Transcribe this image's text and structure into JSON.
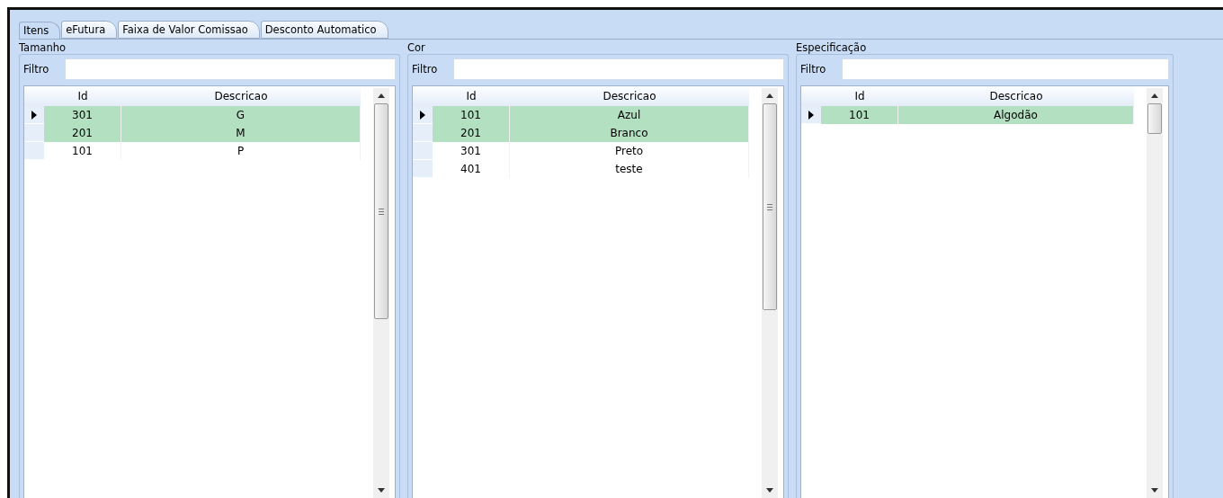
{
  "tabs": [
    {
      "label": "Itens",
      "selected": true
    },
    {
      "label": "eFutura",
      "selected": false
    },
    {
      "label": "Faixa de Valor Comissao",
      "selected": false
    },
    {
      "label": "Desconto Automatico",
      "selected": false
    }
  ],
  "panels": [
    {
      "title": "Tamanho",
      "filter_label": "Filtro",
      "columns": [
        "Id",
        "Descricao"
      ],
      "rows": [
        {
          "id": "301",
          "descricao": "G",
          "selected": true,
          "current": true
        },
        {
          "id": "201",
          "descricao": "M",
          "selected": true,
          "current": false
        },
        {
          "id": "101",
          "descricao": "P",
          "selected": false,
          "current": false
        }
      ]
    },
    {
      "title": "Cor",
      "filter_label": "Filtro",
      "columns": [
        "Id",
        "Descricao"
      ],
      "rows": [
        {
          "id": "101",
          "descricao": "Azul",
          "selected": true,
          "current": true
        },
        {
          "id": "201",
          "descricao": "Branco",
          "selected": true,
          "current": false
        },
        {
          "id": "301",
          "descricao": "Preto",
          "selected": false,
          "current": false
        },
        {
          "id": "401",
          "descricao": "teste",
          "selected": false,
          "current": false
        }
      ]
    },
    {
      "title": "Especificação",
      "filter_label": "Filtro",
      "columns": [
        "Id",
        "Descricao"
      ],
      "rows": [
        {
          "id": "101",
          "descricao": "Algodão",
          "selected": true,
          "current": true
        }
      ]
    }
  ]
}
